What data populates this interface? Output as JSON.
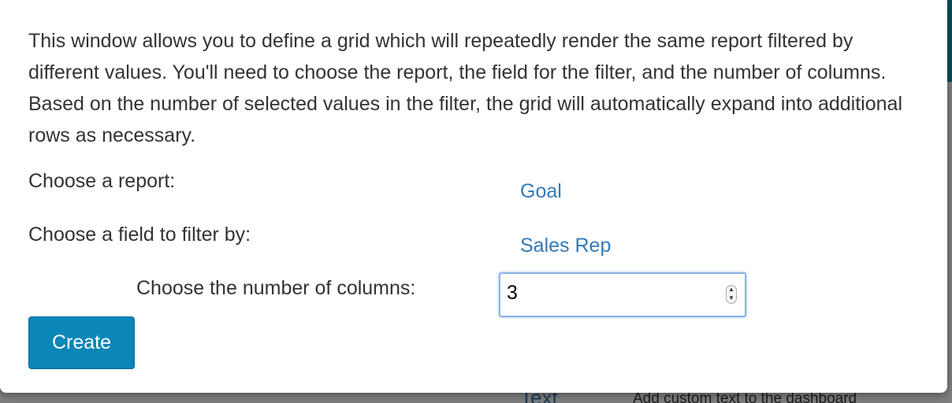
{
  "background": {
    "text_link": "Text",
    "text_description": "Add custom text to the dashboard"
  },
  "modal": {
    "intro": "This window allows you to define a grid which will repeatedly render the same report filtered by different values. You'll need to choose the report, the field for the filter, and the number of columns. Based on the number of selected values in the filter, the grid will automatically expand into additional rows as necessary.",
    "report_label": "Choose a report:",
    "report_value": "Goal",
    "field_label": "Choose a field to filter by:",
    "field_value": "Sales Rep",
    "columns_label": "Choose the number of columns:",
    "columns_value": "3",
    "create_label": "Create"
  },
  "colors": {
    "link": "#337ab7",
    "button": "#0b86b8",
    "header": "#0c4a5e"
  }
}
